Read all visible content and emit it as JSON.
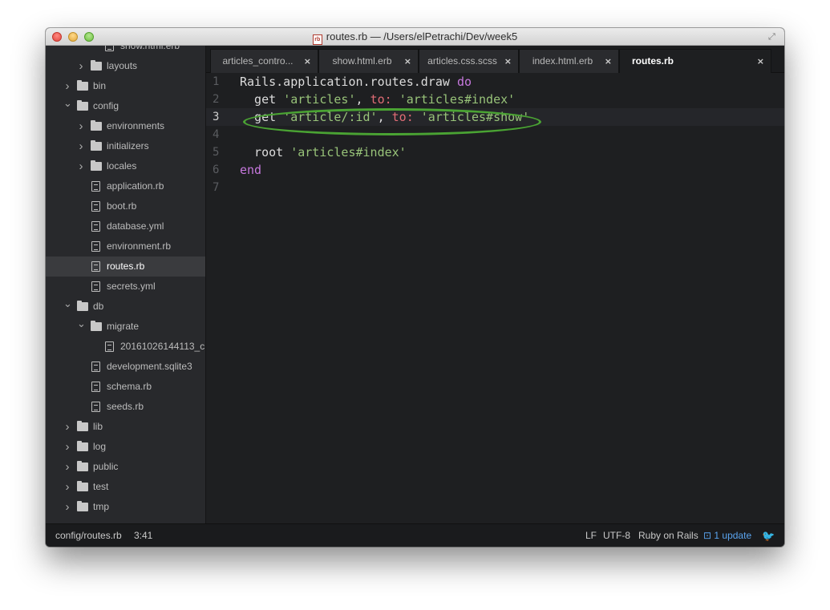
{
  "window": {
    "title": "routes.rb — /Users/elPetrachi/Dev/week5",
    "file_icon": "rb"
  },
  "sidebar": {
    "items": [
      {
        "label": "show.html.erb",
        "type": "file",
        "depth": 3
      },
      {
        "label": "layouts",
        "type": "folder",
        "depth": 2,
        "expanded": false
      },
      {
        "label": "bin",
        "type": "folder",
        "depth": 1,
        "expanded": false
      },
      {
        "label": "config",
        "type": "folder",
        "depth": 1,
        "expanded": true
      },
      {
        "label": "environments",
        "type": "folder",
        "depth": 2,
        "expanded": false
      },
      {
        "label": "initializers",
        "type": "folder",
        "depth": 2,
        "expanded": false
      },
      {
        "label": "locales",
        "type": "folder",
        "depth": 2,
        "expanded": false
      },
      {
        "label": "application.rb",
        "type": "file",
        "depth": 2
      },
      {
        "label": "boot.rb",
        "type": "file",
        "depth": 2
      },
      {
        "label": "database.yml",
        "type": "file",
        "depth": 2
      },
      {
        "label": "environment.rb",
        "type": "file",
        "depth": 2
      },
      {
        "label": "routes.rb",
        "type": "file",
        "depth": 2,
        "selected": true
      },
      {
        "label": "secrets.yml",
        "type": "file",
        "depth": 2
      },
      {
        "label": "db",
        "type": "folder",
        "depth": 1,
        "expanded": true
      },
      {
        "label": "migrate",
        "type": "folder",
        "depth": 2,
        "expanded": true
      },
      {
        "label": "20161026144113_c",
        "type": "file",
        "depth": 3
      },
      {
        "label": "development.sqlite3",
        "type": "file",
        "depth": 2
      },
      {
        "label": "schema.rb",
        "type": "file",
        "depth": 2
      },
      {
        "label": "seeds.rb",
        "type": "file",
        "depth": 2
      },
      {
        "label": "lib",
        "type": "folder",
        "depth": 1,
        "expanded": false
      },
      {
        "label": "log",
        "type": "folder",
        "depth": 1,
        "expanded": false
      },
      {
        "label": "public",
        "type": "folder",
        "depth": 1,
        "expanded": false
      },
      {
        "label": "test",
        "type": "folder",
        "depth": 1,
        "expanded": false
      },
      {
        "label": "tmp",
        "type": "folder",
        "depth": 1,
        "expanded": false
      }
    ]
  },
  "tabs": [
    {
      "label": "articles_contro...",
      "close": "×"
    },
    {
      "label": "show.html.erb",
      "close": "×"
    },
    {
      "label": "articles.css.scss",
      "close": "×"
    },
    {
      "label": "index.html.erb",
      "close": "×"
    },
    {
      "label": "routes.rb",
      "close": "×",
      "active": true
    }
  ],
  "editor": {
    "current_line": 3,
    "lines": [
      {
        "num": "1",
        "tokens": [
          {
            "t": "Rails.application.routes.draw ",
            "c": "fn"
          },
          {
            "t": "do",
            "c": "kw"
          }
        ]
      },
      {
        "num": "2",
        "tokens": [
          {
            "t": "  get ",
            "c": "fn"
          },
          {
            "t": "'articles'",
            "c": "str"
          },
          {
            "t": ", ",
            "c": "fn"
          },
          {
            "t": "to:",
            "c": "sym"
          },
          {
            "t": " ",
            "c": "fn"
          },
          {
            "t": "'articles#index'",
            "c": "str"
          }
        ]
      },
      {
        "num": "3",
        "tokens": [
          {
            "t": "  get ",
            "c": "fn"
          },
          {
            "t": "'article/:id'",
            "c": "str"
          },
          {
            "t": ", ",
            "c": "fn"
          },
          {
            "t": "to:",
            "c": "sym"
          },
          {
            "t": " ",
            "c": "fn"
          },
          {
            "t": "'articles#show'",
            "c": "str"
          }
        ]
      },
      {
        "num": "4",
        "tokens": []
      },
      {
        "num": "5",
        "tokens": [
          {
            "t": "  root ",
            "c": "fn"
          },
          {
            "t": "'articles#index'",
            "c": "str"
          }
        ]
      },
      {
        "num": "6",
        "tokens": [
          {
            "t": "end",
            "c": "kw"
          }
        ]
      },
      {
        "num": "7",
        "tokens": []
      }
    ]
  },
  "statusbar": {
    "path": "config/routes.rb",
    "cursor": "3:41",
    "line_ending": "LF",
    "encoding": "UTF-8",
    "grammar": "Ruby on Rails",
    "update": "1 update",
    "update_icon": "package-icon",
    "bird_icon": "squirrel-icon"
  },
  "colors": {
    "keyword": "#c678dd",
    "string": "#98c379",
    "symbol": "#e06c75",
    "highlight_ellipse": "#4aa333",
    "update_link": "#5aa4ef"
  }
}
